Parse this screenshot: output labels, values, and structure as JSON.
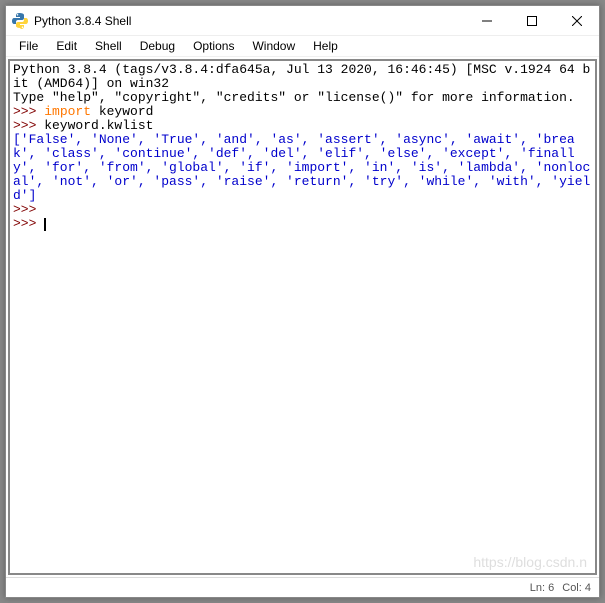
{
  "window": {
    "title": "Python 3.8.4 Shell"
  },
  "menubar": {
    "items": [
      "File",
      "Edit",
      "Shell",
      "Debug",
      "Options",
      "Window",
      "Help"
    ]
  },
  "terminal": {
    "banner_line1": "Python 3.8.4 (tags/v3.8.4:dfa645a, Jul 13 2020, 16:46:45) [MSC v.1924 64 bit (AMD64)] on win32",
    "banner_line2": "Type \"help\", \"copyright\", \"credits\" or \"license()\" for more information.",
    "prompt": ">>>",
    "line1_kw": "import",
    "line1_txt": " keyword",
    "line2_txt": " keyword.kwlist",
    "output_list": "['False', 'None', 'True', 'and', 'as', 'assert', 'async', 'await', 'break', 'class', 'continue', 'def', 'del', 'elif', 'else', 'except', 'finally', 'for', 'from', 'global', 'if', 'import', 'in', 'is', 'lambda', 'nonlocal', 'not', 'or', 'pass', 'raise', 'return', 'try', 'while', 'with', 'yield']"
  },
  "statusbar": {
    "ln": "Ln: 6",
    "col": "Col: 4"
  },
  "watermark": "https://blog.csdn.n"
}
